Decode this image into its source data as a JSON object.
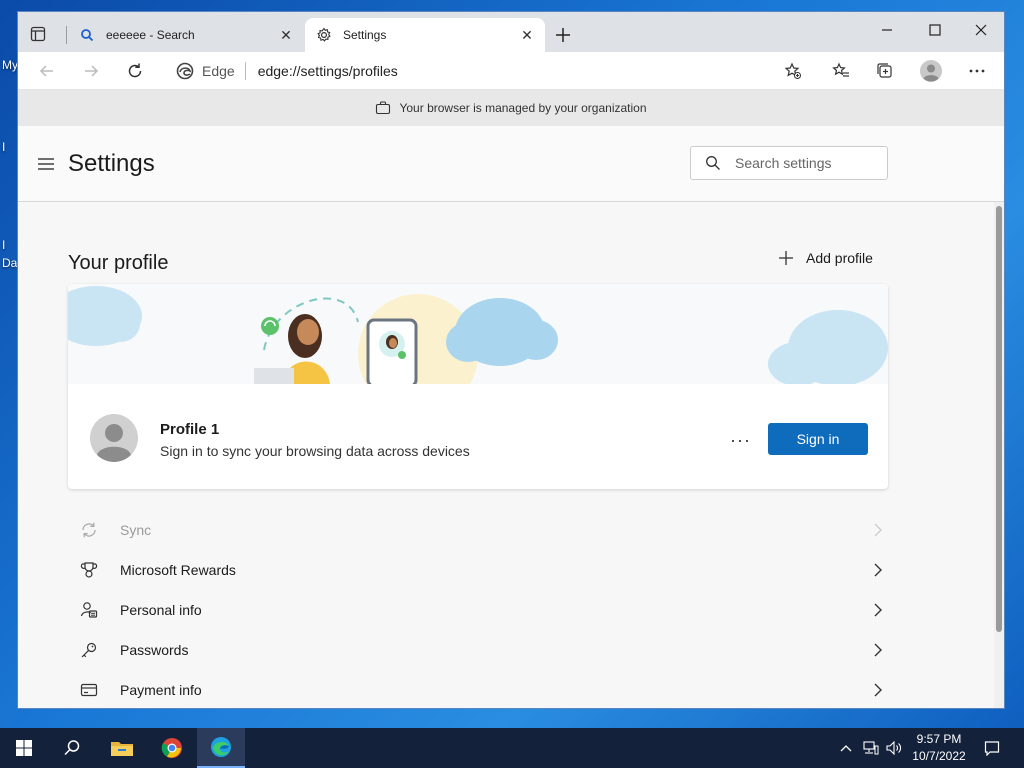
{
  "desktop": {
    "labels": [
      "My",
      "I",
      "I",
      "Da"
    ]
  },
  "tabs": [
    {
      "title": "eeeeee - Search",
      "icon": "search-icon",
      "active": false
    },
    {
      "title": "Settings",
      "icon": "gear-icon",
      "active": true
    }
  ],
  "toolbar": {
    "site_label": "Edge",
    "url": "edge://settings/profiles"
  },
  "managed_notice": "Your browser is managed by your organization",
  "header": {
    "title": "Settings",
    "search_placeholder": "Search settings"
  },
  "profile_section": {
    "heading": "Your profile",
    "add_profile_label": "Add profile",
    "profile_name": "Profile 1",
    "profile_subtitle": "Sign in to sync your browsing data across devices",
    "more_label": "···",
    "sign_in_label": "Sign in"
  },
  "settings_list": [
    {
      "label": "Sync",
      "icon": "sync-icon",
      "disabled": true
    },
    {
      "label": "Microsoft Rewards",
      "icon": "trophy-icon",
      "disabled": false
    },
    {
      "label": "Personal info",
      "icon": "personal-info-icon",
      "disabled": false
    },
    {
      "label": "Passwords",
      "icon": "key-icon",
      "disabled": false
    },
    {
      "label": "Payment info",
      "icon": "card-icon",
      "disabled": false
    }
  ],
  "taskbar": {
    "time": "9:57 PM",
    "date": "10/7/2022"
  },
  "colors": {
    "accent": "#0f6cbd",
    "taskbar": "#14213a"
  }
}
